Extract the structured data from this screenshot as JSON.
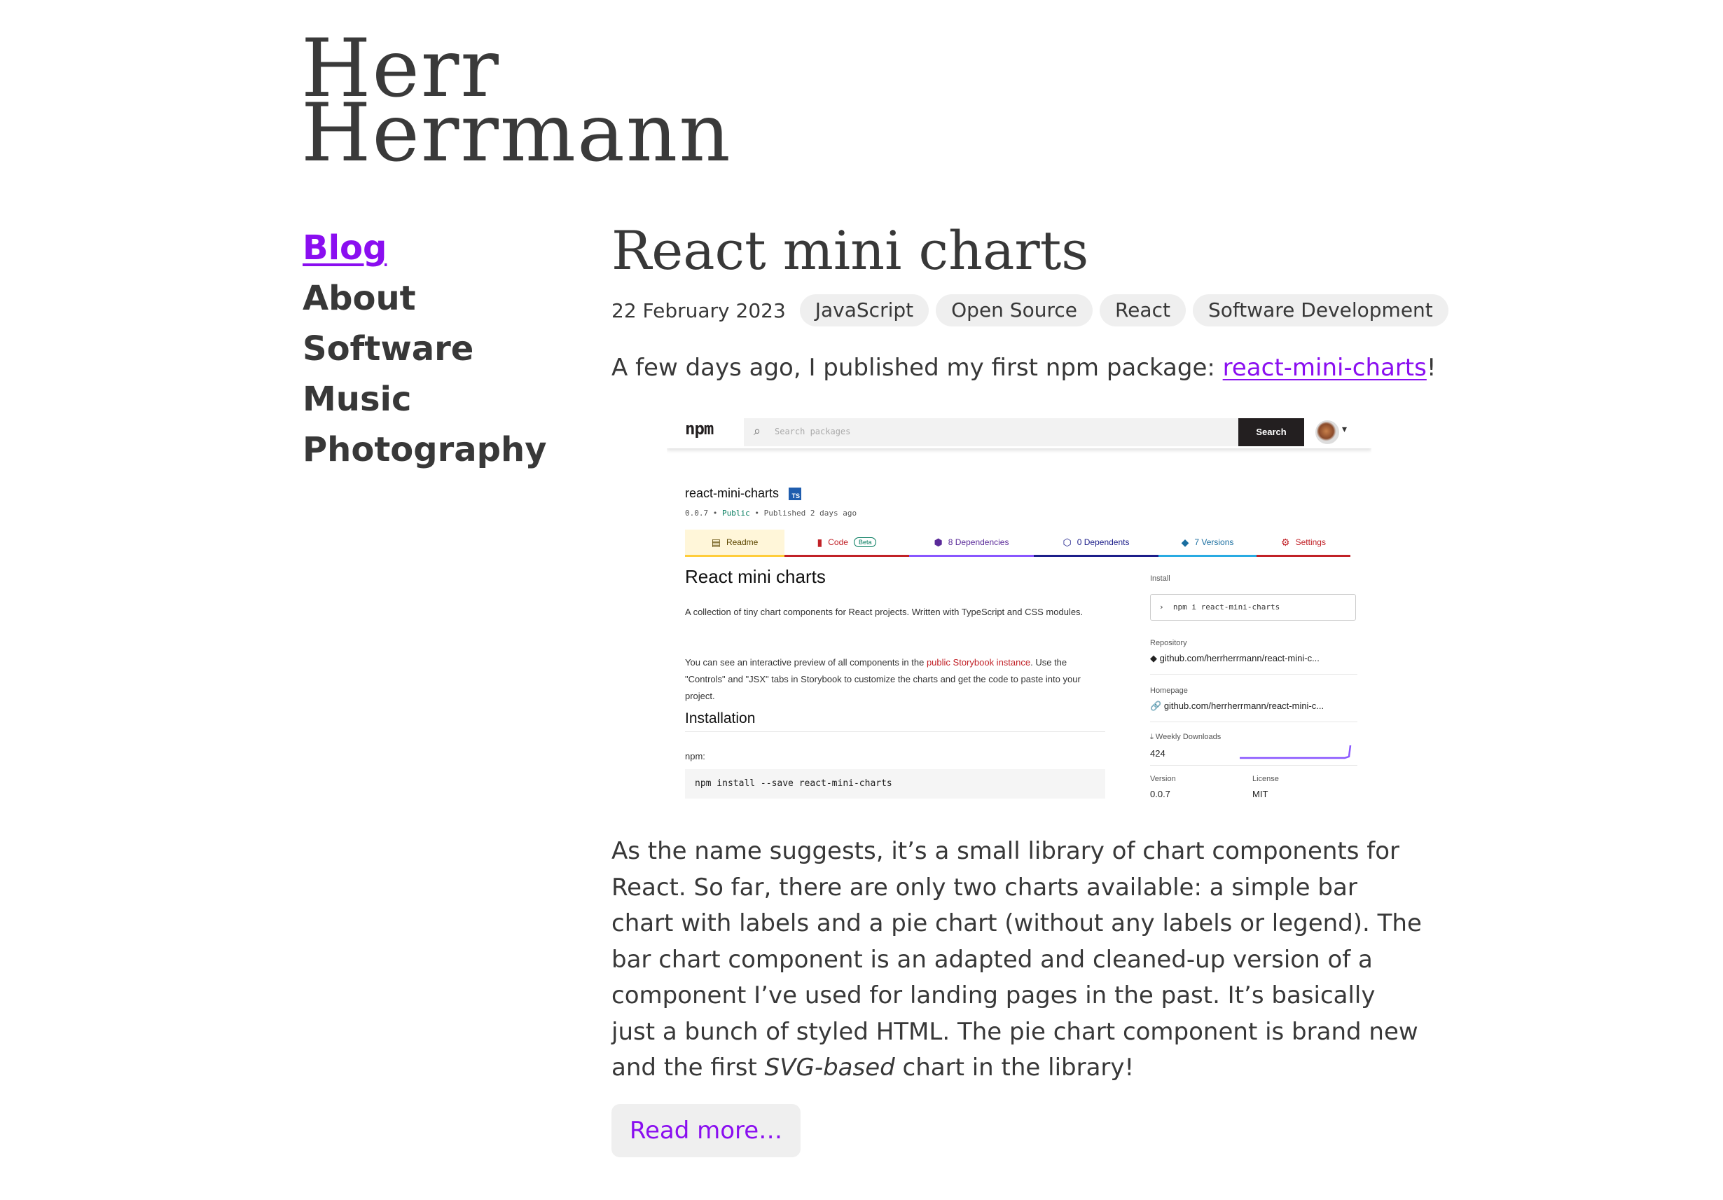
{
  "site": {
    "title_line1": "Herr",
    "title_line2": "Herrmann"
  },
  "nav": {
    "items": [
      {
        "label": "Blog"
      },
      {
        "label": "About"
      },
      {
        "label": "Software"
      },
      {
        "label": "Music"
      },
      {
        "label": "Photography"
      }
    ],
    "active": "Blog"
  },
  "post": {
    "title": "React mini charts",
    "date": "22 February 2023",
    "tags": [
      "JavaScript",
      "Open Source",
      "React",
      "Software Development"
    ],
    "intro_text": "A few days ago, I published my first npm package: ",
    "intro_link": "react-mini-charts",
    "intro_end": "!",
    "body_part1": "As the name suggests, it’s a small library of chart components for React. So far, there are only two charts available: a simple bar chart with labels and a pie chart (without any labels or legend). The bar chart component is an adapted and cleaned-up version of a component I’ve used for landing pages in the past. It’s basically just a bunch of styled HTML. The pie chart component is brand new and the first ",
    "body_em": "SVG-based",
    "body_part2": " chart in the library!",
    "read_more": "Read more…"
  },
  "screenshot": {
    "logo": "npm",
    "search_placeholder": "Search packages",
    "search_button": "Search",
    "package_name": "react-mini-charts",
    "ts_badge": "TS",
    "version_meta": "0.0.7",
    "visibility": "Public",
    "published": "Published 2 days ago",
    "tabs": [
      {
        "label": "Readme",
        "color": "#ffcd3a",
        "icon": "📄"
      },
      {
        "label": "Code",
        "color": "#c12127",
        "icon": "📕",
        "badge": "Beta"
      },
      {
        "label": "8 Dependencies",
        "color": "#8956ff",
        "icon": "📦"
      },
      {
        "label": "0 Dependents",
        "color": "#1c1e8a",
        "icon": "🧊"
      },
      {
        "label": "7 Versions",
        "color": "#29abe2",
        "icon": "🏷"
      },
      {
        "label": "Settings",
        "color": "#c12127",
        "icon": "⚙"
      }
    ],
    "readme_title": "React mini charts",
    "readme_p1": "A collection of tiny chart components for React projects. Written with TypeScript and CSS modules.",
    "readme_p2_a": "You can see an interactive preview of all components in the ",
    "readme_p2_link": "public Storybook instance",
    "readme_p2_b": ". Use the \"Controls\" and \"JSX\" tabs in Storybook to customize the charts and get the code to paste into your project.",
    "installation_title": "Installation",
    "npm_label": "npm:",
    "install_code": "npm install --save react-mini-charts",
    "side": {
      "install_label": "Install",
      "install_cmd": "npm i react-mini-charts",
      "repo_label": "Repository",
      "repo_value": "github.com/herrherrmann/react-mini-c...",
      "home_label": "Homepage",
      "home_value": "github.com/herrherrmann/react-mini-c...",
      "downloads_label": "Weekly Downloads",
      "downloads_value": "424",
      "version_label": "Version",
      "version_value": "0.0.7",
      "license_label": "License",
      "license_value": "MIT"
    }
  }
}
